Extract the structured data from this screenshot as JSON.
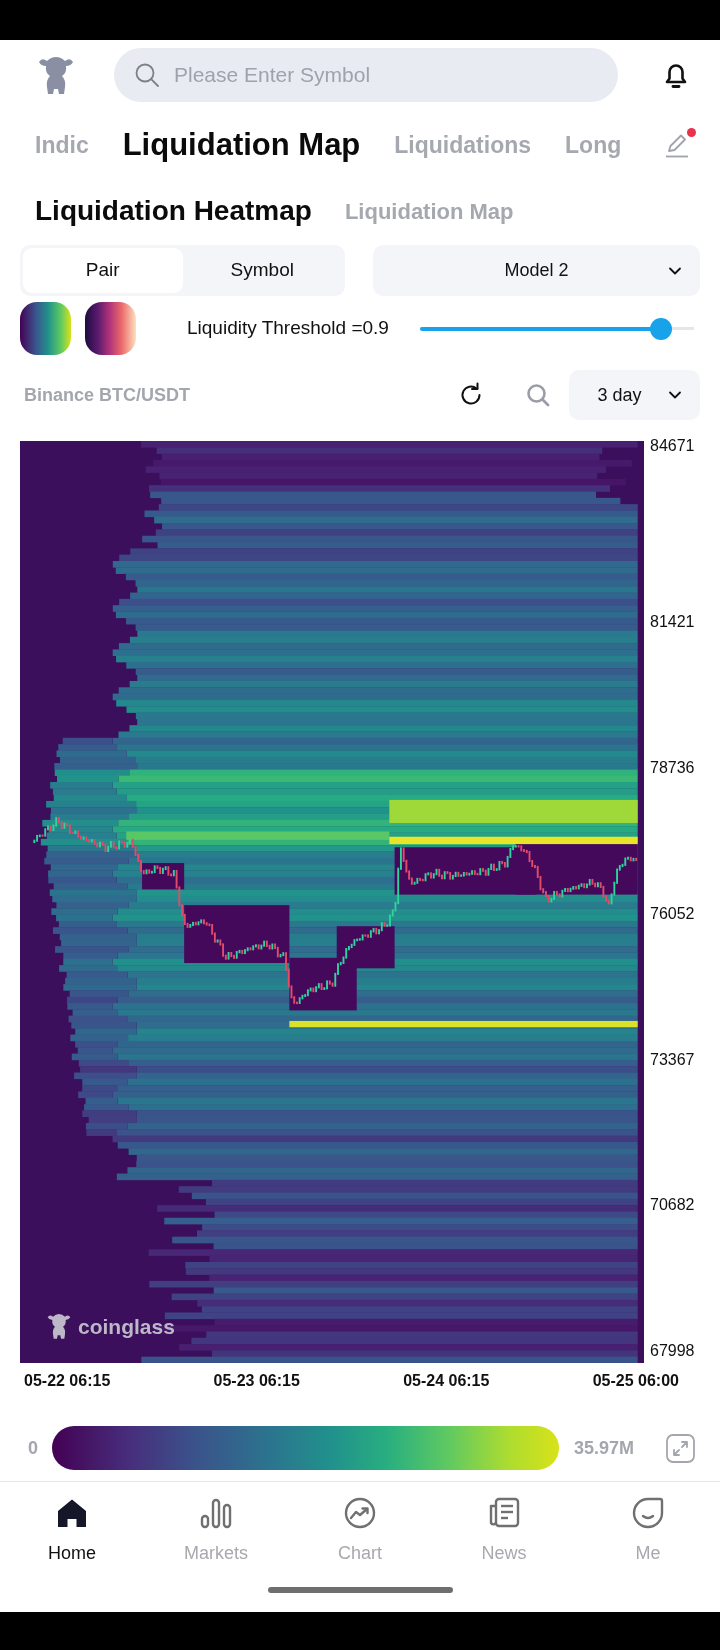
{
  "header": {
    "search": {
      "placeholder": "Please Enter Symbol"
    }
  },
  "tabs": [
    {
      "label": "Indic",
      "selected": false
    },
    {
      "label": "Liquidation Map",
      "selected": true
    },
    {
      "label": "Liquidations",
      "selected": false
    },
    {
      "label": "Long",
      "selected": false
    }
  ],
  "edit_button": {
    "badge": true
  },
  "views": [
    {
      "label": "Liquidation Heatmap",
      "selected": true
    },
    {
      "label": "Liquidation Map",
      "selected": false
    }
  ],
  "segments": [
    {
      "label": "Pair",
      "selected": true
    },
    {
      "label": "Symbol",
      "selected": false
    }
  ],
  "model_select": {
    "value": "Model 2"
  },
  "palettes": [
    {
      "kind": "viridis"
    },
    {
      "kind": "magma"
    }
  ],
  "threshold": {
    "label": "Liquidity Threshold =0.9",
    "level": 0.88
  },
  "toolbar": {
    "pair": "Binance BTC/USDT",
    "range": "3 day"
  },
  "chart": {
    "watermark": "coinglass",
    "y_labels": [
      "84671",
      "81421",
      "78736",
      "76052",
      "73367",
      "70682",
      "67998"
    ],
    "x_labels": [
      "05-22 06:15",
      "05-23 06:15",
      "05-24 06:15",
      "05-25 06:00"
    ]
  },
  "color_scale": {
    "min": "0",
    "max": "35.97M"
  },
  "bottom_nav": [
    {
      "kind": "home",
      "label": "Home",
      "selected": true
    },
    {
      "kind": "markets",
      "label": "Markets",
      "selected": false
    },
    {
      "kind": "chart",
      "label": "Chart",
      "selected": false
    },
    {
      "kind": "news",
      "label": "News",
      "selected": false
    },
    {
      "kind": "me",
      "label": "Me",
      "selected": false
    }
  ]
}
